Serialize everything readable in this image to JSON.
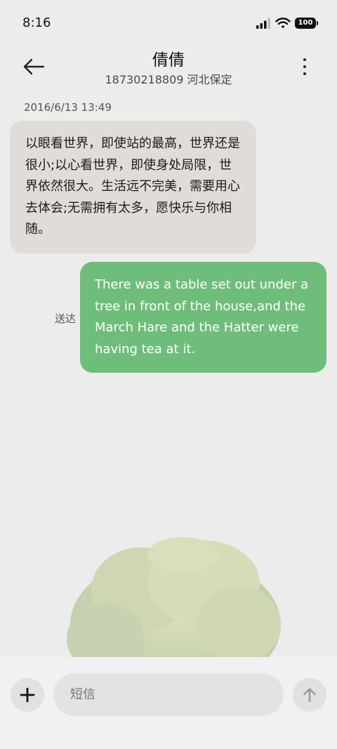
{
  "status_bar": {
    "time": "8:16",
    "battery": "100",
    "icons": [
      "signal-icon",
      "wifi-icon",
      "battery-icon"
    ]
  },
  "header": {
    "contact_name": "倩倩",
    "contact_subtitle": "18730218809 河北保定",
    "icons": [
      "back-arrow-icon",
      "more-vertical-icon"
    ]
  },
  "conversation": {
    "timestamp": "2016/6/13 13:49",
    "messages": [
      {
        "direction": "incoming",
        "text": "以眼看世界，即使站的最高，世界还是很小;以心看世界，即使身处局限，世界依然很大。生活远不完美，需要用心去体会;无需拥有太多，愿快乐与你相随。"
      },
      {
        "direction": "outgoing",
        "text": "There was a table set out under a tree in front of the house,and the March Hare and the Hatter were having tea at it.",
        "status": "送达"
      }
    ]
  },
  "composer": {
    "placeholder": "短信",
    "icons": [
      "plus-icon",
      "send-arrow-icon"
    ]
  },
  "colors": {
    "background": "#ececec",
    "incoming_bubble": "#e0dcd8",
    "outgoing_bubble": "#6fbd7a",
    "composer_bg": "#f1f1f1"
  }
}
